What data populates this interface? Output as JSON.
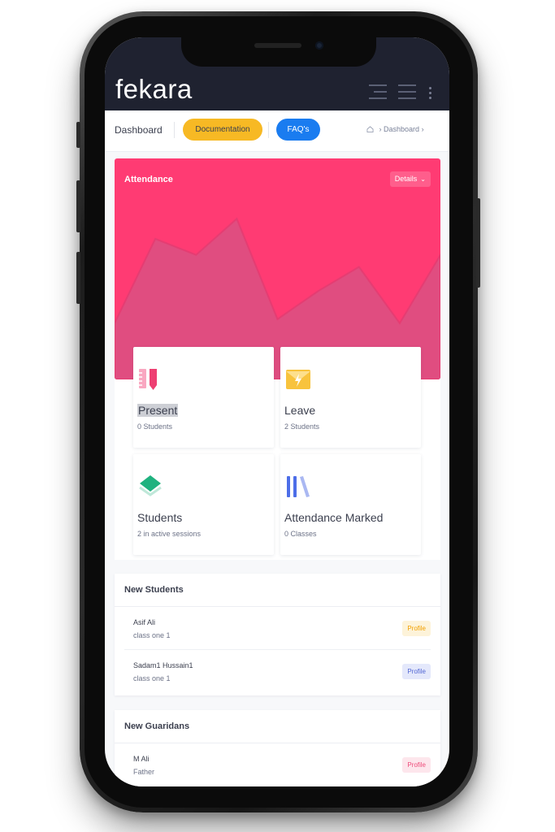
{
  "app": {
    "logo_text": "fekara"
  },
  "subheader": {
    "title": "Dashboard",
    "documentation_label": "Documentation",
    "faq_label": "FAQ's",
    "breadcrumb": "Dashboard"
  },
  "attendance": {
    "title": "Attendance",
    "details_label": "Details",
    "chart_data": {
      "type": "area",
      "x": [
        1,
        2,
        3,
        4,
        5,
        6,
        7,
        8,
        9
      ],
      "values": [
        14,
        35,
        31,
        40,
        15,
        22,
        28,
        14,
        31
      ],
      "ylim": [
        0,
        55
      ],
      "color": "#e04d80",
      "grid": false,
      "title": "",
      "xlabel": "",
      "ylabel": ""
    }
  },
  "stats": [
    {
      "name": "Present",
      "sub": "0 Students",
      "icon": "ruler-pencil-icon"
    },
    {
      "name": "Leave",
      "sub": "2 Students",
      "icon": "envelope-icon"
    },
    {
      "name": "Students",
      "sub": "2 in active sessions",
      "icon": "layers-icon"
    },
    {
      "name": "Attendance Marked",
      "sub": "0 Classes",
      "icon": "books-icon"
    }
  ],
  "new_students": {
    "title": "New Students",
    "items": [
      {
        "name": "Asif Ali",
        "sub": "class one 1",
        "action": "Profile"
      },
      {
        "name": "Sadam1 Hussain1",
        "sub": "class one 1",
        "action": "Profile"
      }
    ]
  },
  "new_guardians": {
    "title": "New Guaridans",
    "items": [
      {
        "name": "M Ali",
        "sub": "Father",
        "action": "Profile"
      }
    ]
  },
  "colors": {
    "header_bg": "#1f2230",
    "accent_pink": "#ff3b73",
    "accent_yellow": "#f7b924",
    "accent_blue": "#1a7cf0"
  }
}
